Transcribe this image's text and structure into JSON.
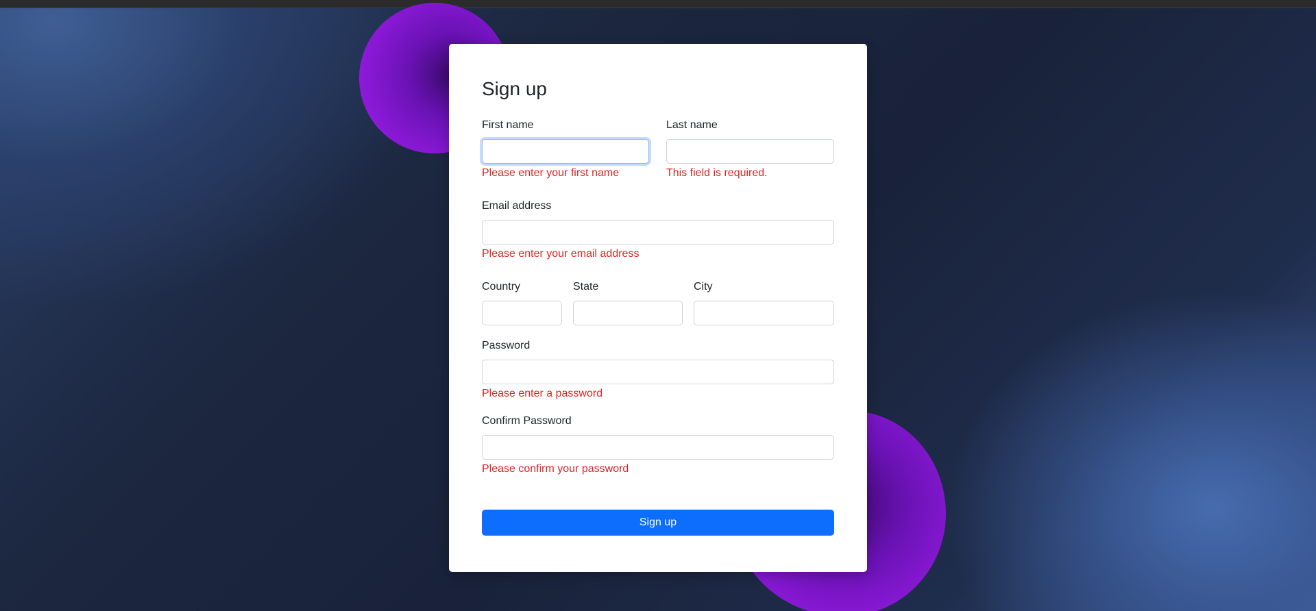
{
  "form": {
    "title": "Sign up",
    "first_name": {
      "label": "First name",
      "value": "",
      "error": "Please enter your first name"
    },
    "last_name": {
      "label": "Last name",
      "value": "",
      "error": "This field is required."
    },
    "email": {
      "label": "Email address",
      "value": "",
      "error": "Please enter your email address"
    },
    "country": {
      "label": "Country",
      "value": ""
    },
    "state": {
      "label": "State",
      "value": ""
    },
    "city": {
      "label": "City",
      "value": ""
    },
    "password": {
      "label": "Password",
      "value": "",
      "error": "Please enter a password"
    },
    "confirm_password": {
      "label": "Confirm Password",
      "value": "",
      "error": "Please confirm your password"
    },
    "submit_label": "Sign up"
  },
  "colors": {
    "primary": "#0d6efd",
    "error": "#e02424",
    "blob": "#8a19d6"
  }
}
